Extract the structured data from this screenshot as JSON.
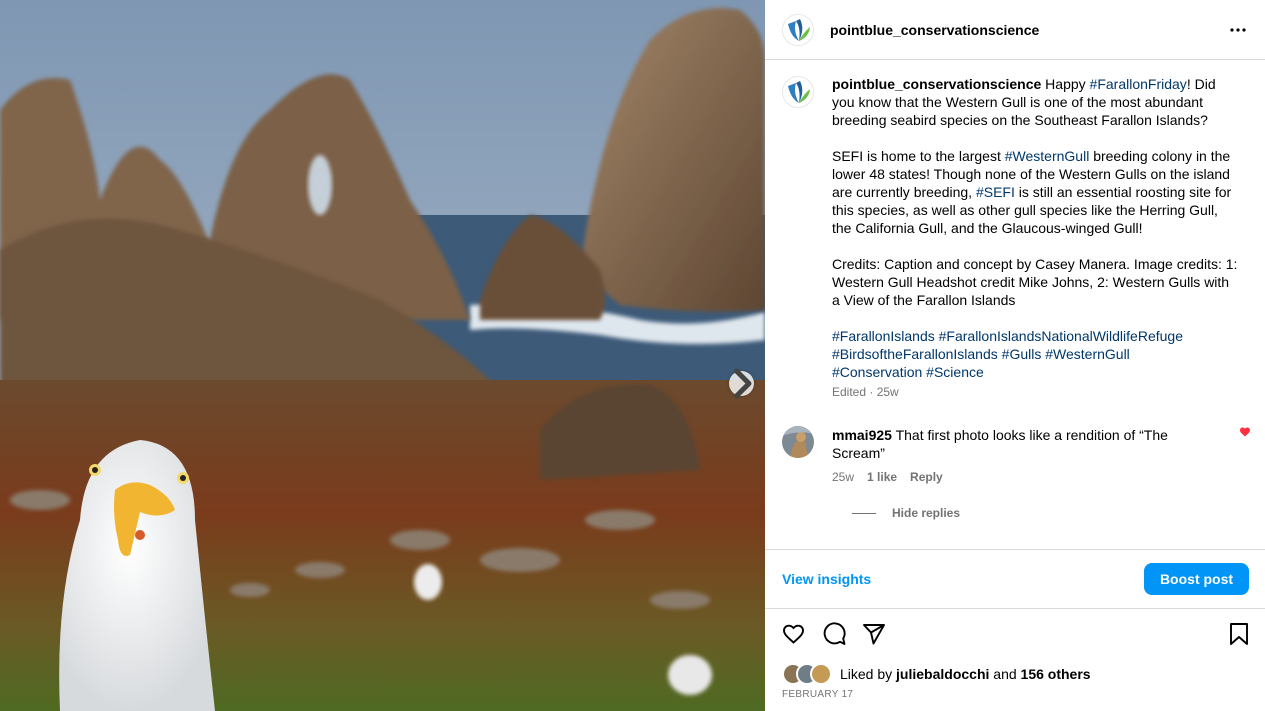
{
  "post": {
    "username": "pointblue_conservationscience",
    "photo_alt": "Western Gull headshot in front of Farallon Islands rocks"
  },
  "caption": {
    "username": "pointblue_conservationscience",
    "p1_a": " Happy ",
    "p1_tag": "#FarallonFriday",
    "p1_b": "! Did you know that the Western Gull is one of the most abundant breeding seabird species on the Southeast Farallon Islands?",
    "p2_a": "SEFI is home to the largest ",
    "p2_tag1": "#WesternGull",
    "p2_b": " breeding colony in the lower 48 states! Though none of the Western Gulls on the island are currently breeding, ",
    "p2_tag2": "#SEFI",
    "p2_c": " is still an essential roosting site for this species, as well as other gull species like the Herring Gull, the California Gull, and the Glaucous-winged Gull!",
    "p3": "Credits: Caption and concept by Casey Manera. Image credits: 1: Western Gull Headshot credit Mike Johns, 2: Western Gulls with a View of the Farallon Islands",
    "tags": [
      "#FarallonIslands",
      "#FarallonIslandsNationalWildlifeRefuge",
      "#BirdsoftheFarallonIslands",
      "#Gulls",
      "#WesternGull",
      "#Conservation",
      "#Science"
    ],
    "edited": "Edited · 25w"
  },
  "comment": {
    "username": "mmai925",
    "text": " That first photo looks like a rendition of “The Scream”",
    "time": "25w",
    "likes": "1 like",
    "reply": "Reply",
    "hide_replies": "Hide replies"
  },
  "insights": {
    "view_label": "View insights",
    "boost_label": "Boost post"
  },
  "likes": {
    "prefix": "Liked by ",
    "user": "juliebaldocchi",
    "mid": " and ",
    "count": "156 others"
  },
  "date": "FEBRUARY 17",
  "colors": {
    "link": "#00376b",
    "accent": "#0095f6",
    "heart": "#ff3040",
    "muted": "#737373"
  }
}
